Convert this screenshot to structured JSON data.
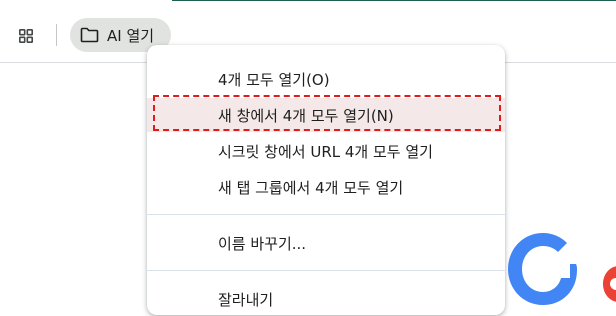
{
  "bookmarks_bar": {
    "apps_icon": "grid-icon",
    "folder_icon": "folder-icon",
    "folder_label": "AI 열기"
  },
  "context_menu": {
    "items": [
      {
        "label": "4개 모두 열기(O)"
      },
      {
        "label": "새 창에서 4개 모두 열기(N)",
        "highlighted": true
      },
      {
        "label": "시크릿 창에서 URL 4개 모두 열기"
      },
      {
        "label": "새 탭 그룹에서 4개 모두 열기"
      },
      {
        "label": "이름 바꾸기..."
      },
      {
        "label": "잘라내기"
      }
    ]
  },
  "colors": {
    "highlight_outline": "#e01b1b",
    "highlight_fill": "#f4e8e8",
    "chip_bg": "#e1e3e1",
    "google_blue": "#4285F4",
    "google_red": "#EA4335"
  }
}
